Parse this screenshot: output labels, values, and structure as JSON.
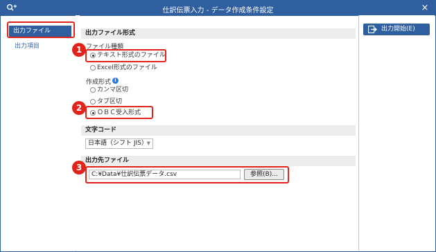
{
  "window": {
    "title": "仕訳伝票入力 - データ作成条件設定",
    "close_label": "×"
  },
  "sidebar": {
    "items": [
      {
        "label": "出力ファイル"
      },
      {
        "label": "出力項目"
      }
    ]
  },
  "main": {
    "format_section": "出力ファイル形式",
    "file_type_label": "ファイル種類",
    "file_types": [
      {
        "label": "テキスト形式のファイル",
        "selected": true
      },
      {
        "label": "Excel形式のファイル",
        "selected": false
      }
    ],
    "creation_format_label": "作成形式",
    "creation_formats": [
      {
        "label": "カンマ区切",
        "selected": false
      },
      {
        "label": "タブ区切",
        "selected": false
      },
      {
        "label": "ＯＢＣ受入形式",
        "selected": true
      }
    ],
    "charcode_section": "文字コード",
    "charcode_value": "日本語（シフト JIS）",
    "dest_section": "出力先ファイル",
    "dest_path": "C:¥Data¥仕訳伝票データ.csv",
    "browse_label": "参照(B)..."
  },
  "actions": {
    "output_start_label": "出力開始(E)"
  },
  "markers": [
    "1",
    "2",
    "3"
  ],
  "colors": {
    "accent": "#2f5f9e",
    "highlight": "#e2231a",
    "info": "#2d7bd8"
  }
}
